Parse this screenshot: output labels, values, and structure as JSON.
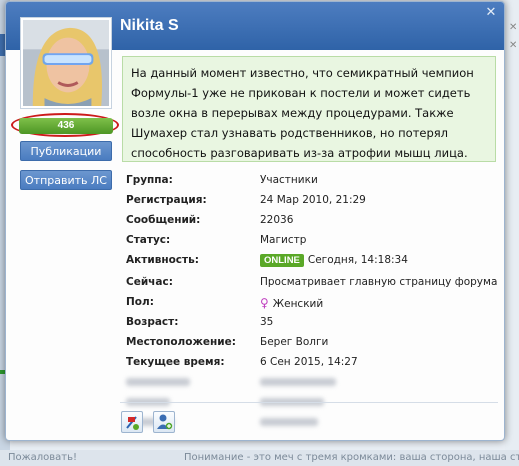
{
  "background": {
    "bottom_left": "Пожаловать!",
    "bottom_right": "Понимание - это меч с тремя кромками: ваша сторона, наша сторона, и правда"
  },
  "profile": {
    "name": "Nikita S",
    "reputation": "436",
    "status_message": "На данный момент известно, что семикратный чемпион Формулы-1 уже не прикован к постели и может сидеть возле окна в перерывах между процедурами. Также Шумахер стал узнавать родственников, но потерял способность разговаривать из-за атрофии мышц лица."
  },
  "buttons": {
    "publications": "Публикации",
    "send_pm": "Отправить ЛС"
  },
  "fields": {
    "group_label": "Группа:",
    "group_value": "Участники",
    "reg_label": "Регистрация:",
    "reg_value": "24 Мар 2010, 21:29",
    "posts_label": "Сообщений:",
    "posts_value": "22036",
    "status_label": "Статус:",
    "status_value": "Магистр",
    "activity_label": "Активность:",
    "online_badge": "ONLINE",
    "activity_value": "Сегодня, 14:18:34",
    "now_label": "Сейчас:",
    "now_value": "Просматривает главную страницу форума",
    "gender_label": "Пол:",
    "gender_value": "Женский",
    "age_label": "Возраст:",
    "age_value": "35",
    "location_label": "Местоположение:",
    "location_value": "Берег Волги",
    "time_label": "Текущее время:",
    "time_value": "6 Сен 2015, 14:27"
  },
  "icons": {
    "close": "close-icon",
    "female": "female-icon",
    "report": "report-icon",
    "add_friend": "add-friend-icon"
  },
  "colors": {
    "header": "#3a6db2",
    "reputation": "#5aa827",
    "status_bg": "#e9f6e1",
    "highlight_ring": "#cc1a1a"
  }
}
